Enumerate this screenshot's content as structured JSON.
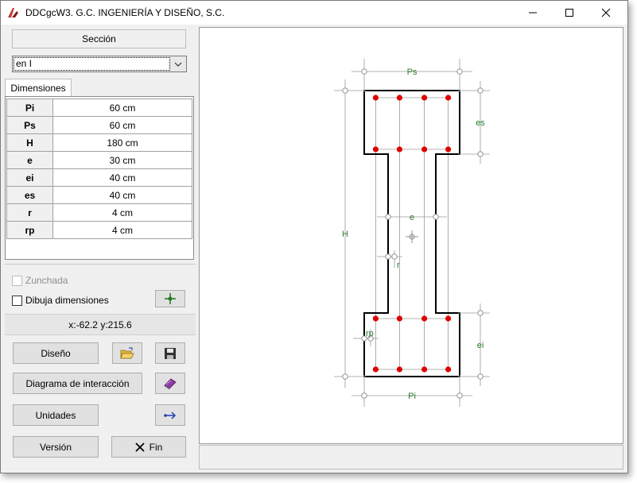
{
  "window": {
    "title": "DDCgcW3. G.C. INGENIERÍA Y DISEÑO, S.C."
  },
  "panel": {
    "section_label": "Sección",
    "section_type": "en I",
    "tab_label": "Dimensiones",
    "dimensions": [
      {
        "name": "Pi",
        "value": "60 cm"
      },
      {
        "name": "Ps",
        "value": "60 cm"
      },
      {
        "name": "H",
        "value": "180 cm"
      },
      {
        "name": "e",
        "value": "30 cm"
      },
      {
        "name": "ei",
        "value": "40 cm"
      },
      {
        "name": "es",
        "value": "40 cm"
      },
      {
        "name": "r",
        "value": "4 cm"
      },
      {
        "name": "rp",
        "value": "4 cm"
      }
    ],
    "zunchada_label": "Zunchada",
    "dibuja_label": "Dibuja dimensiones",
    "coords": "x:-62.2 y:215.6"
  },
  "buttons": {
    "diseno": "Diseño",
    "diagrama": "Diagrama de interacción",
    "unidades": "Unidades",
    "version": "Versión",
    "fin": "Fin"
  },
  "drawing": {
    "labels": {
      "ps": "Ps",
      "pi": "Pi",
      "es": "es",
      "ei": "ei",
      "h": "H",
      "e": "e",
      "r": "r",
      "rp": "rp"
    },
    "colors": {
      "outline": "#000000",
      "rebar": "#e00000",
      "dim_text": "#2e7d2e",
      "dim_line": "#9a9a9a"
    }
  },
  "icons": {
    "app": "app-logo-icon",
    "open": "folder-open-icon",
    "save": "floppy-disk-icon",
    "book": "book-icon",
    "units": "arrow-swap-icon",
    "close": "close-x-icon",
    "crosshair": "crosshair-icon"
  }
}
